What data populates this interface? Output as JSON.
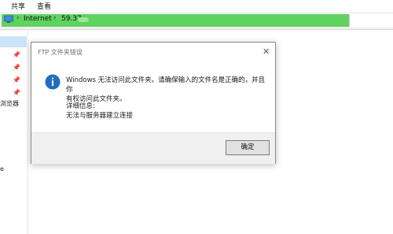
{
  "ribbon": {
    "tabs": [
      "共享",
      "查看"
    ]
  },
  "address": {
    "segments": [
      "Internet",
      "59.37."
    ]
  },
  "sidebar": {
    "labels": [
      "浏览器",
      "e"
    ]
  },
  "dialog": {
    "title": "FTP 文件夹错误",
    "message_line1": "Windows 无法访问此文件夹。请确保输入的文件名是正确的，并且你",
    "message_line2": "有权访问此文件夹。",
    "details_heading": "详细信息:",
    "details_text": "无法与服务器建立连接",
    "ok_label": "确定"
  },
  "colors": {
    "accent": "#1e6fc0",
    "address_highlight": "#5fd35f"
  },
  "icons": {
    "info": "info-icon",
    "close": "close-icon",
    "pin": "pin-icon"
  }
}
